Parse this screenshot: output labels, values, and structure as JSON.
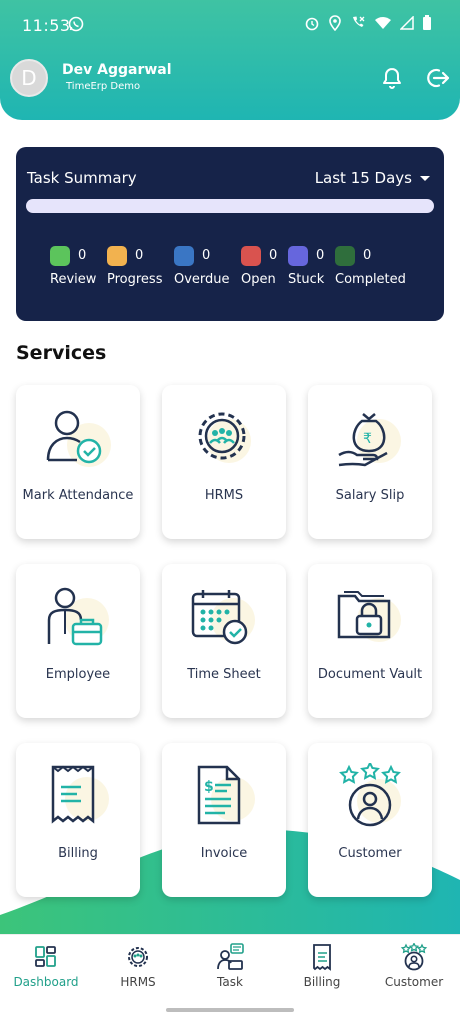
{
  "status_bar": {
    "time": "11:53"
  },
  "header": {
    "avatar_initial": "D",
    "user_name": "Dev Aggarwal",
    "company": "TimeErp Demo"
  },
  "task_summary": {
    "title": "Task Summary",
    "range": "Last 15 Days",
    "legend": [
      {
        "label": "Review",
        "count": "0",
        "color": "#5cc45c"
      },
      {
        "label": "Progress",
        "count": "0",
        "color": "#f2b24f"
      },
      {
        "label": "Overdue",
        "count": "0",
        "color": "#3a76c4"
      },
      {
        "label": "Open",
        "count": "0",
        "color": "#d9534f"
      },
      {
        "label": "Stuck",
        "count": "0",
        "color": "#6666dd"
      },
      {
        "label": "Completed",
        "count": "0",
        "color": "#2f6e3c"
      }
    ]
  },
  "services": {
    "title": "Services",
    "items": [
      {
        "label": "Mark Attendance",
        "icon": "user-check-icon"
      },
      {
        "label": "HRMS",
        "icon": "gear-team-icon"
      },
      {
        "label": "Salary Slip",
        "icon": "money-bag-hand-icon"
      },
      {
        "label": "Employee",
        "icon": "employee-briefcase-icon"
      },
      {
        "label": "Time Sheet",
        "icon": "calendar-check-icon"
      },
      {
        "label": "Document Vault",
        "icon": "folder-lock-icon"
      },
      {
        "label": "Billing",
        "icon": "receipt-icon"
      },
      {
        "label": "Invoice",
        "icon": "invoice-dollar-icon"
      },
      {
        "label": "Customer",
        "icon": "customer-stars-icon"
      }
    ]
  },
  "bottom_nav": {
    "items": [
      {
        "label": "Dashboard",
        "icon": "dashboard-icon",
        "active": true
      },
      {
        "label": "HRMS",
        "icon": "hrms-icon"
      },
      {
        "label": "Task",
        "icon": "task-icon"
      },
      {
        "label": "Billing",
        "icon": "billing-icon"
      },
      {
        "label": "Customer",
        "icon": "customer-icon"
      }
    ]
  },
  "colors": {
    "brand_teal": "#1fb5b2",
    "brand_green": "#3fc3a3",
    "card_navy": "#162349",
    "active_nav": "#21a08a"
  }
}
